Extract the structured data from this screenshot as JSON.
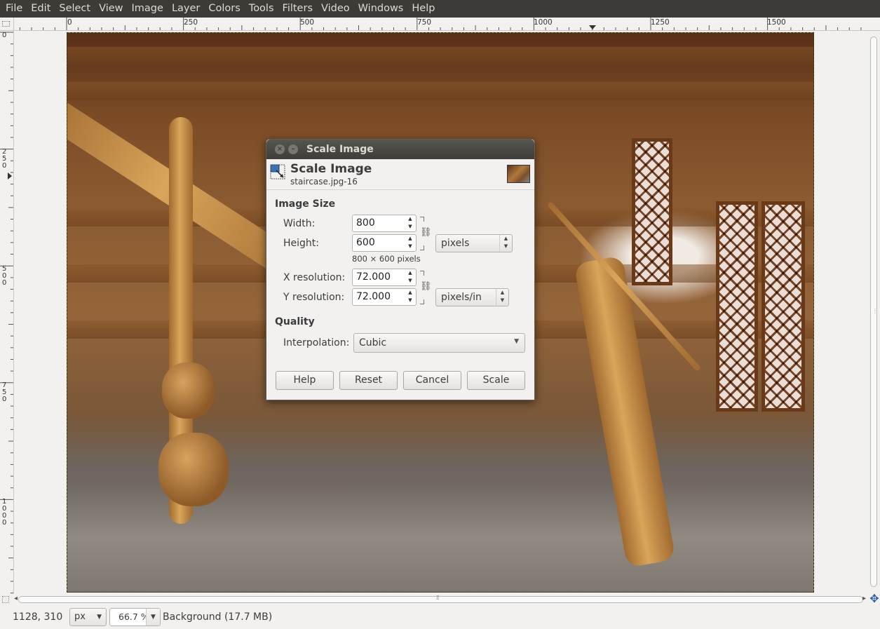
{
  "menubar": {
    "items": [
      "File",
      "Edit",
      "Select",
      "View",
      "Image",
      "Layer",
      "Colors",
      "Tools",
      "Filters",
      "Video",
      "Windows",
      "Help"
    ]
  },
  "rulers": {
    "horizontal_labels": [
      "0",
      "250",
      "500",
      "750",
      "1000",
      "1250",
      "1500"
    ],
    "vertical_labels": [
      "0",
      "250",
      "500",
      "750",
      "1000"
    ]
  },
  "icons": {
    "dialog_header": "scale-image-icon",
    "chain_link": "chain-link-icon",
    "navigate": "navigate-icon",
    "quick_mask": "quick-mask-icon"
  },
  "dialog": {
    "window_title": "Scale Image",
    "header_title": "Scale Image",
    "header_subtitle": "staircase.jpg-16",
    "image_size_label": "Image Size",
    "width_label": "Width:",
    "width_value": "800",
    "height_label": "Height:",
    "height_value": "600",
    "size_unit": "pixels",
    "size_info": "800 × 600 pixels",
    "xres_label": "X resolution:",
    "xres_value": "72.000",
    "yres_label": "Y resolution:",
    "yres_value": "72.000",
    "res_unit": "pixels/in",
    "quality_label": "Quality",
    "interpolation_label": "Interpolation:",
    "interpolation_value": "Cubic",
    "buttons": {
      "help": "Help",
      "reset": "Reset",
      "cancel": "Cancel",
      "scale": "Scale"
    }
  },
  "statusbar": {
    "coords": "1128, 310",
    "unit": "px",
    "zoom": "66.7 %",
    "layer_info": "Background (17.7 MB)"
  },
  "colors": {
    "menubar_bg": "#3c3b37",
    "menubar_text": "#dfdbd2",
    "window_bg": "#f2f1f0",
    "dialog_title_bg": "#3e3d39"
  }
}
